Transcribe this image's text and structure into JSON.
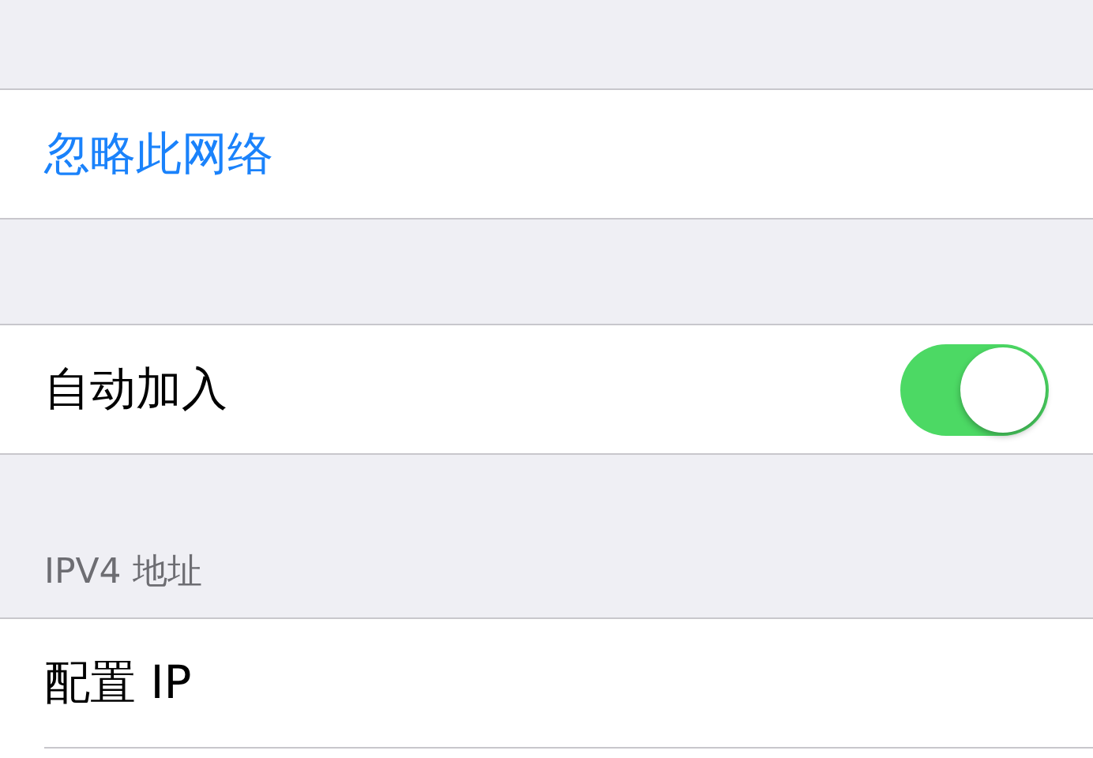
{
  "forget_network": {
    "label": "忽略此网络"
  },
  "auto_join": {
    "label": "自动加入",
    "on": true
  },
  "ipv4": {
    "header": "IPV4 地址",
    "configure_ip": {
      "label": "配置 IP"
    }
  }
}
